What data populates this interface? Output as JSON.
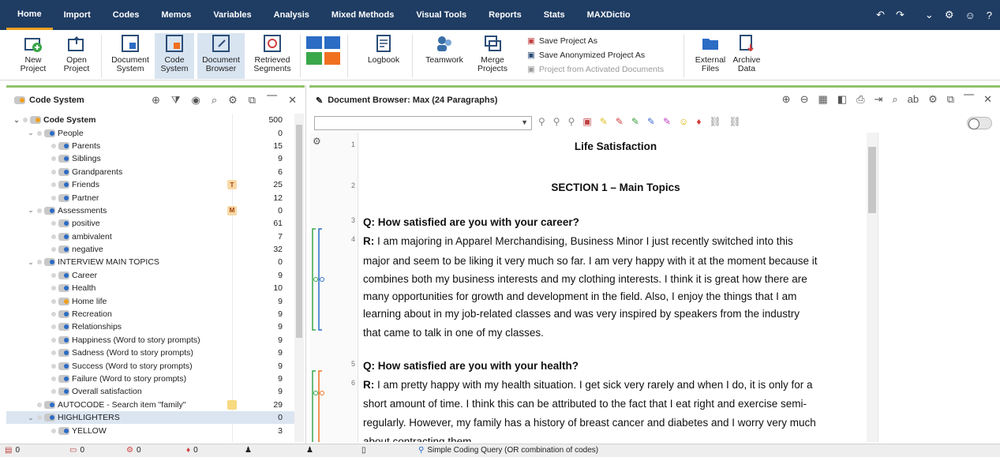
{
  "menu": {
    "items": [
      "Home",
      "Import",
      "Codes",
      "Memos",
      "Variables",
      "Analysis",
      "Mixed Methods",
      "Visual Tools",
      "Reports",
      "Stats",
      "MAXDictio"
    ],
    "active": "Home"
  },
  "ribbon": {
    "new_project": [
      "New",
      "Project"
    ],
    "open_project": [
      "Open",
      "Project"
    ],
    "document_system": [
      "Document",
      "System"
    ],
    "code_system": [
      "Code",
      "System"
    ],
    "document_browser": [
      "Document",
      "Browser"
    ],
    "retrieved_segments": [
      "Retrieved",
      "Segments"
    ],
    "logbook": "Logbook",
    "teamwork": "Teamwork",
    "merge_projects": [
      "Merge",
      "Projects"
    ],
    "save_project_as": "Save Project As",
    "save_anonymized": "Save Anonymized Project As",
    "project_from_activated": "Project from Activated Documents",
    "external_files": [
      "External",
      "Files"
    ],
    "archive_data": [
      "Archive",
      "Data"
    ]
  },
  "code_system": {
    "title": "Code System",
    "rows": [
      {
        "label": "Code System",
        "count": "500",
        "level": 0,
        "root": true
      },
      {
        "label": "People",
        "count": "0",
        "level": 1
      },
      {
        "label": "Parents",
        "count": "15",
        "level": 2
      },
      {
        "label": "Siblings",
        "count": "9",
        "level": 2
      },
      {
        "label": "Grandparents",
        "count": "6",
        "level": 2
      },
      {
        "label": "Friends",
        "count": "25",
        "level": 2,
        "memo": "T"
      },
      {
        "label": "Partner",
        "count": "12",
        "level": 2
      },
      {
        "label": "Assessments",
        "count": "0",
        "level": 1,
        "memo": "M"
      },
      {
        "label": "positive",
        "count": "61",
        "level": 2
      },
      {
        "label": "ambivalent",
        "count": "7",
        "level": 2
      },
      {
        "label": "negative",
        "count": "32",
        "level": 2
      },
      {
        "label": "INTERVIEW MAIN TOPICS",
        "count": "0",
        "level": 1
      },
      {
        "label": "Career",
        "count": "9",
        "level": 2
      },
      {
        "label": "Health",
        "count": "10",
        "level": 2
      },
      {
        "label": "Home life",
        "count": "9",
        "level": 2
      },
      {
        "label": "Recreation",
        "count": "9",
        "level": 2
      },
      {
        "label": "Relationships",
        "count": "9",
        "level": 2
      },
      {
        "label": "Happiness (Word to story prompts)",
        "count": "9",
        "level": 2
      },
      {
        "label": "Sadness (Word to story prompts)",
        "count": "9",
        "level": 2
      },
      {
        "label": "Success (Word to story prompts)",
        "count": "9",
        "level": 2
      },
      {
        "label": "Failure (Word to story prompts)",
        "count": "9",
        "level": 2
      },
      {
        "label": "Overall satisfaction",
        "count": "9",
        "level": 2
      },
      {
        "label": "AUTOCODE - Search item \"family\"",
        "count": "29",
        "level": 1,
        "memo": " "
      },
      {
        "label": "HIGHLIGHTERS",
        "count": "0",
        "level": 1
      },
      {
        "label": "YELLOW",
        "count": "3",
        "level": 2
      }
    ]
  },
  "document_browser": {
    "title": "Document Browser: Max  (24 Paragraphs)",
    "lines": [
      {
        "para": "1",
        "text": "Life Satisfaction",
        "style": "center"
      },
      {
        "para": "2",
        "text": "SECTION 1 – Main Topics",
        "style": "center"
      },
      {
        "para": "3",
        "text": "Q: How satisfied are you with your career?",
        "style": "q"
      },
      {
        "para": "4",
        "prefix": "R:",
        "text": " I am majoring in Apparel Merchandising, Business Minor I just recently switched into this"
      },
      {
        "para": "",
        "text": "major and seem to be liking it very much so far. I am very happy with it at the moment because it"
      },
      {
        "para": "",
        "text": "combines both my business interests and my clothing interests. I think it is great how there are"
      },
      {
        "para": "",
        "text": "many opportunities for growth and development in the field. Also, I enjoy the things that I am"
      },
      {
        "para": "",
        "text": "learning about in my job-related classes and was very inspired by speakers from the industry"
      },
      {
        "para": "",
        "text": "that came to talk in one of my classes."
      },
      {
        "para": "5",
        "text": "Q: How satisfied are you with your health?",
        "style": "q"
      },
      {
        "para": "6",
        "prefix": "R:",
        "text": " I am pretty happy with my health situation. I get sick very rarely and when I do, it is only for a"
      },
      {
        "para": "",
        "text": "short amount of time. I think this can be attributed to the fact that I eat right and exercise semi-"
      },
      {
        "para": "",
        "text": "regularly. However, my family has a history of breast cancer and diabetes and I worry very much"
      },
      {
        "para": "",
        "text": "about contracting them."
      }
    ]
  },
  "status": {
    "docs": "0",
    "segments": "0",
    "codes": "0",
    "memos": "0",
    "query": "Simple Coding Query (OR combination of codes)"
  },
  "colors": {
    "menu_bg": "#1f3c63",
    "accent_green": "#92c36b",
    "selected": "#dbe5f1"
  }
}
